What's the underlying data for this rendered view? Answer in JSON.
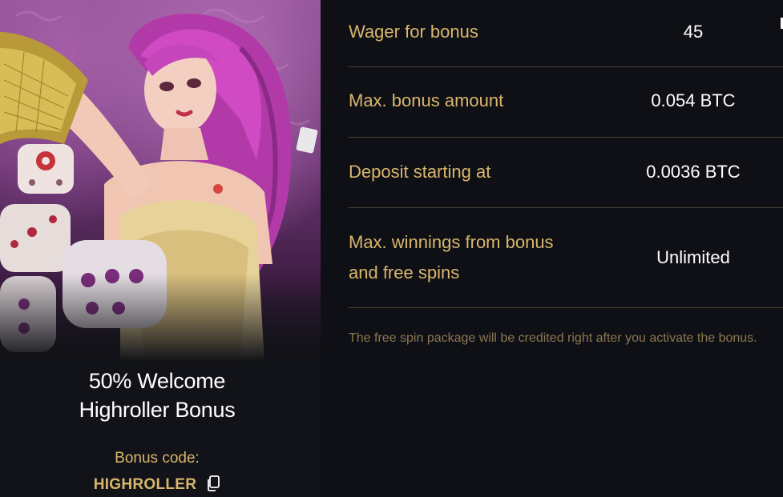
{
  "promo": {
    "title_line1": "50% Welcome",
    "title_line2": "Highroller Bonus",
    "bonus_code_label": "Bonus code:",
    "bonus_code": "HIGHROLLER"
  },
  "details": [
    {
      "label": "Wager for bonus",
      "value": "45"
    },
    {
      "label": "Max. bonus amount",
      "value": "0.054 BTC"
    },
    {
      "label": "Deposit starting at",
      "value": "0.0036 BTC"
    },
    {
      "label": "Max. winnings from bonus and free spins",
      "value": "Unlimited"
    }
  ],
  "footnote": "The free spin package will be credited right after you activate the bonus.",
  "colors": {
    "background": "#0f1015",
    "card": "#121318",
    "gold": "#d9b66c",
    "muted_gold": "#8b7751",
    "divider": "#4a4336",
    "text": "#ffffff"
  },
  "icons": {
    "copy": "copy-icon"
  }
}
